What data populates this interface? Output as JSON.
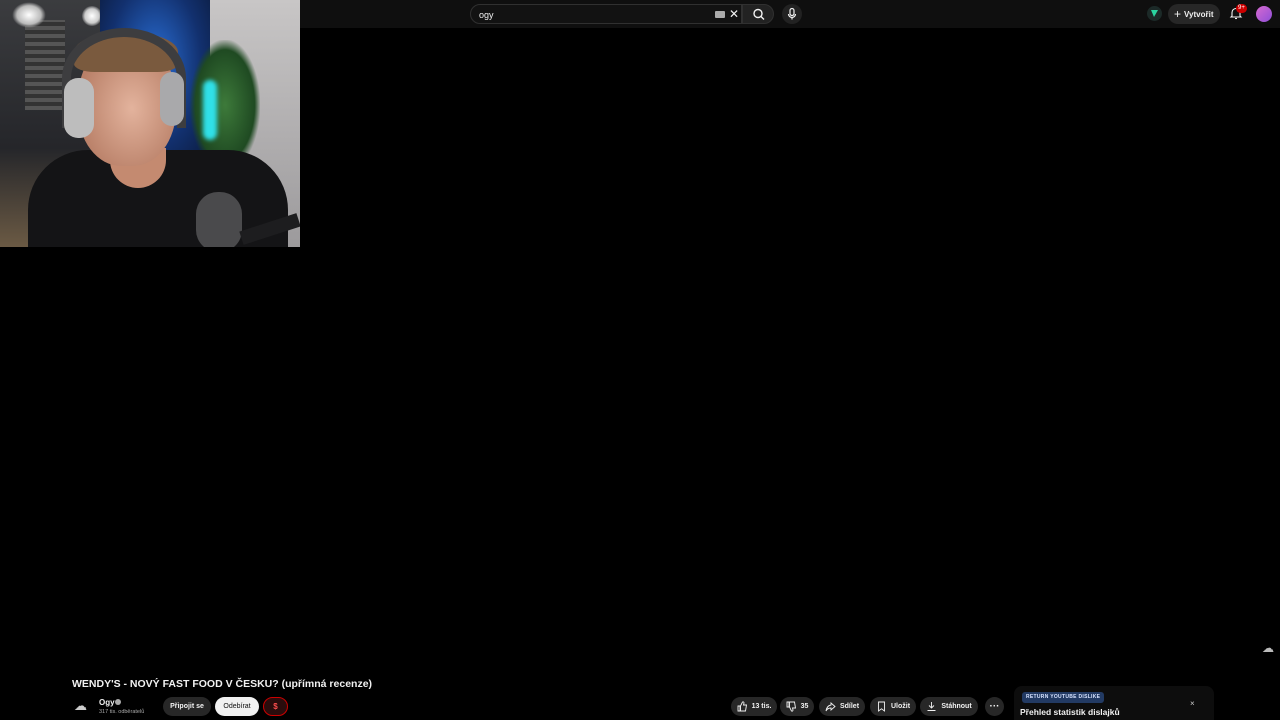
{
  "header": {
    "search_value": "ogy",
    "create_label": "Vytvořit",
    "notification_badge": "9+"
  },
  "video": {
    "title": "WENDY'S - NOVÝ FAST FOOD V ČESKU? (upřímná recenze)",
    "channel_name": "Ogy",
    "subscribers": "317 tis. odběratelů",
    "join_label": "Připojit se",
    "subscribe_label": "Odebírat",
    "dollar_label": "$",
    "likes": "13 tis.",
    "dislikes": "35",
    "share_label": "Sdílet",
    "save_label": "Uložit",
    "download_label": "Stáhnout",
    "more_label": "···"
  },
  "dislike_panel": {
    "badge": "RETURN YOUTUBE DISLIKE",
    "title": "Přehled statistik dislajků",
    "close": "×"
  },
  "icons": {
    "search": "search-icon",
    "mic": "microphone-icon",
    "clear": "close-icon",
    "bell": "bell-icon",
    "like": "thumbs-up-icon",
    "dislike": "thumbs-down-icon",
    "share": "share-icon",
    "save": "bookmark-icon",
    "download": "download-icon"
  },
  "colors": {
    "background": "#000000",
    "topbar": "#0f0f0f",
    "pill": "#272727",
    "accent_red": "#cc0000"
  }
}
